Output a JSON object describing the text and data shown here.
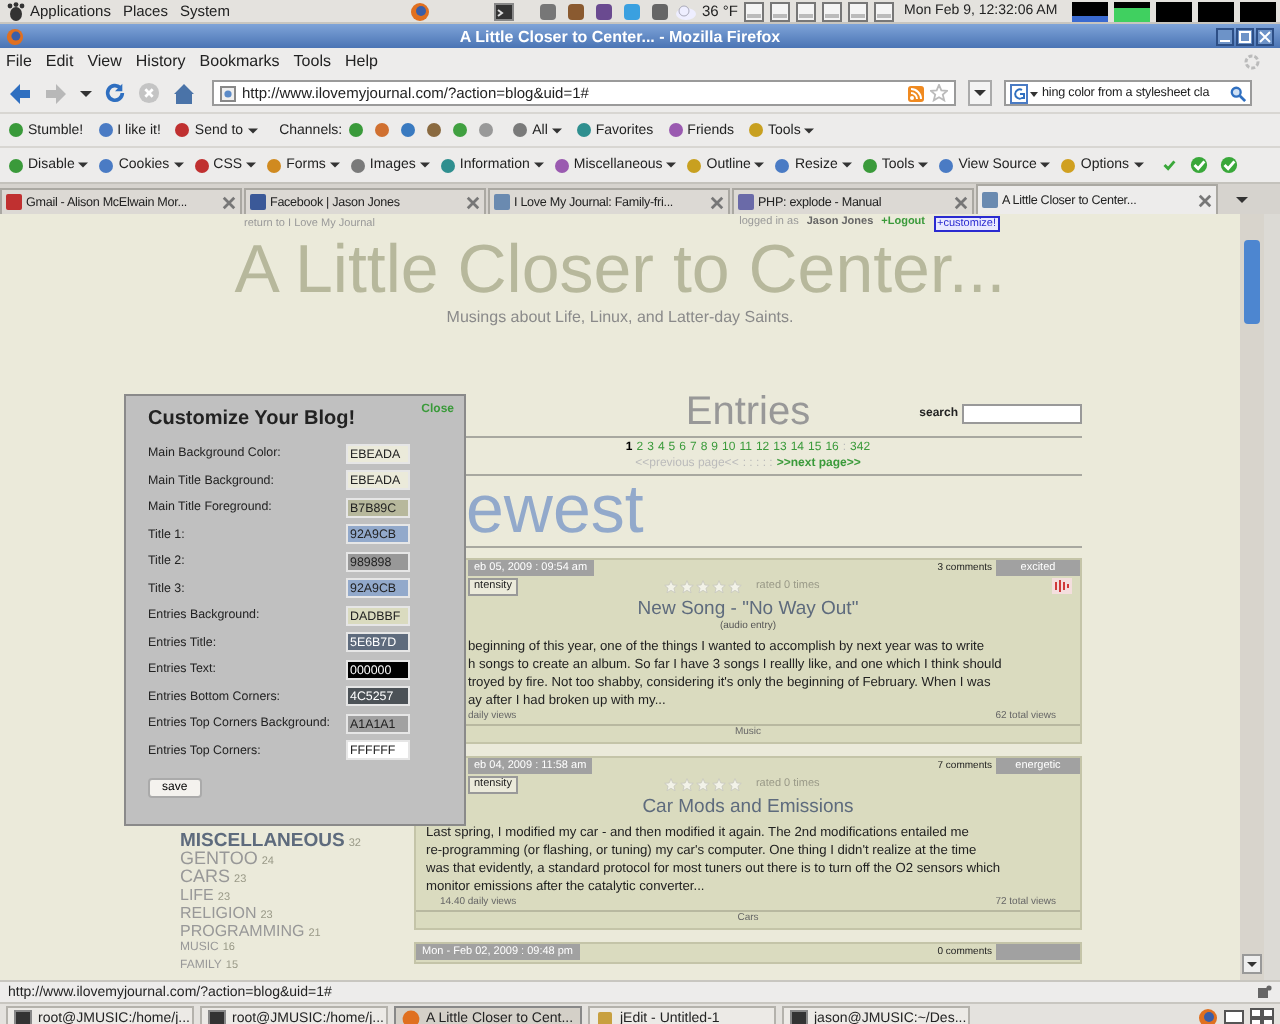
{
  "top_panel": {
    "menus": [
      "Applications",
      "Places",
      "System"
    ],
    "weather": "36 °F",
    "clock": "Mon Feb  9, 12:32:06 AM"
  },
  "window": {
    "title": "A Little Closer to Center... - Mozilla Firefox"
  },
  "menu_bar": [
    "File",
    "Edit",
    "View",
    "History",
    "Bookmarks",
    "Tools",
    "Help"
  ],
  "address_bar": {
    "value": "http://www.ilovemyjournal.com/?action=blog&uid=1#"
  },
  "search_bar": {
    "value": "hing color from a stylesheet cla"
  },
  "stumble_toolbar": [
    {
      "label": "Stumble!",
      "kind": "button"
    },
    {
      "label": "I like it!",
      "kind": "button"
    },
    {
      "label": "Send to",
      "kind": "menu"
    },
    {
      "label": "Channels:",
      "kind": "label"
    },
    {
      "label": "All",
      "kind": "menu"
    },
    {
      "label": "Favorites",
      "kind": "button"
    },
    {
      "label": "Friends",
      "kind": "button"
    },
    {
      "label": "Tools",
      "kind": "menu"
    }
  ],
  "developer_toolbar": [
    "Disable",
    "Cookies",
    "CSS",
    "Forms",
    "Images",
    "Information",
    "Miscellaneous",
    "Outline",
    "Resize",
    "Tools",
    "View Source",
    "Options"
  ],
  "tabs": [
    {
      "label": "Gmail - Alison McElwain Mor...",
      "selected": false
    },
    {
      "label": "Facebook | Jason Jones",
      "selected": false
    },
    {
      "label": "I Love My Journal: Family-fri...",
      "selected": false
    },
    {
      "label": "PHP: explode - Manual",
      "selected": false
    },
    {
      "label": "A Little Closer to Center...",
      "selected": true
    }
  ],
  "page": {
    "return_link": "return to I Love My Journal",
    "logged_in_label": "logged in as",
    "user": "Jason Jones",
    "logout_link": "+Logout",
    "customize_link": "+customize!",
    "title": "A Little Closer to Center...",
    "subtitle": "Musings about Life, Linux, and Latter-day Saints."
  },
  "customize_dialog": {
    "title": "Customize Your Blog!",
    "close": "Close",
    "save": "save",
    "fields": [
      {
        "label": "Main Background Color:",
        "value": "EBEADA",
        "color": "#ebeada"
      },
      {
        "label": "Main Title Background:",
        "value": "EBEADA",
        "color": "#ebeada"
      },
      {
        "label": "Main Title Foreground:",
        "value": "B7B89C",
        "color": "#b7b89c"
      },
      {
        "label": "Title 1:",
        "value": "92A9CB",
        "color": "#92a9cb"
      },
      {
        "label": "Title 2:",
        "value": "989898",
        "color": "#989898"
      },
      {
        "label": "Title 3:",
        "value": "92A9CB",
        "color": "#92a9cb"
      },
      {
        "label": "Entries Background:",
        "value": "DADBBF",
        "color": "#dadbbf"
      },
      {
        "label": "Entries Title:",
        "value": "5E6B7D",
        "color": "#5e6b7d"
      },
      {
        "label": "Entries Text:",
        "value": "000000",
        "color": "#000000"
      },
      {
        "label": "Entries Bottom Corners:",
        "value": "4C5257",
        "color": "#4c5257"
      },
      {
        "label": "Entries Top Corners Background:",
        "value": "A1A1A1",
        "color": "#a1a1a1"
      },
      {
        "label": "Entries Top Corners:",
        "value": "FFFFFF",
        "color": "#ffffff"
      }
    ]
  },
  "categories": [
    {
      "name": "MISCELLANEOUS",
      "count": "32"
    },
    {
      "name": "GENTOO",
      "count": "24"
    },
    {
      "name": "CARS",
      "count": "23"
    },
    {
      "name": "LIFE",
      "count": "23"
    },
    {
      "name": "RELIGION",
      "count": "23"
    },
    {
      "name": "PROGRAMMING",
      "count": "21"
    },
    {
      "name": "MUSIC",
      "count": "16"
    },
    {
      "name": "FAMILY",
      "count": "15"
    }
  ],
  "entries_header": {
    "title": "Entries",
    "search_label": "search",
    "pages": [
      {
        "label": "1",
        "selected": true
      },
      {
        "label": "2",
        "selected": false
      },
      {
        "label": "3",
        "selected": false
      },
      {
        "label": "4",
        "selected": false
      },
      {
        "label": "5",
        "selected": false
      },
      {
        "label": "6",
        "selected": false
      },
      {
        "label": "7",
        "selected": false
      },
      {
        "label": "8",
        "selected": false
      },
      {
        "label": "9",
        "selected": false
      },
      {
        "label": "10",
        "selected": false
      },
      {
        "label": "11",
        "selected": false
      },
      {
        "label": "12",
        "selected": false
      },
      {
        "label": "13",
        "selected": false
      },
      {
        "label": "14",
        "selected": false
      },
      {
        "label": "15",
        "selected": false
      },
      {
        "label": "16",
        "selected": false
      }
    ],
    "ellipsis": ":",
    "last_page": "342",
    "previous": "<<previous page<<",
    "separators": ": : : : :",
    "next": ">>next page>>"
  },
  "section_heading": "ewest",
  "entries": [
    {
      "date": "eb 05, 2009 : 09:54 am",
      "intensity": "ntensity",
      "stars": 0,
      "rating": "rated 0 times",
      "comments": "3 comments",
      "mood": "excited",
      "has_audio": true,
      "title": "New Song - \"No Way Out\"",
      "subtitle": "(audio entry)",
      "body": [
        "beginning of this year, one of the things I wanted to accomplish by next year was to write",
        "h songs to create an album.  So far I have 3 songs I reallly like, and one which I think should",
        "troyed by fire.  Not too shabby, considering it's only the beginning of February. When I was",
        "ay after I had broken up with my..."
      ],
      "daily_views": "daily views",
      "total_views": "62 total views",
      "category": "Music"
    },
    {
      "date": "eb 04, 2009 : 11:58 am",
      "intensity": "ntensity",
      "stars": 0,
      "rating": "rated 0 times",
      "comments": "7 comments",
      "mood": "energetic",
      "has_audio": false,
      "title": "Car Mods and Emissions",
      "body": [
        "Last spring, I modified my car - and then modified it again. The 2nd modifications entailed me",
        "re-programming (or flashing, or tuning) my car's computer.  One thing I didn't realize at the time",
        "was that evidently, a standard protocol for most tuners out there is to turn off the O2 sensors which",
        "monitor emissions after the catalytic converter..."
      ],
      "daily_views": "14.40 daily views",
      "total_views": "72 total views",
      "category": "Cars"
    },
    {
      "date": "Mon - Feb 02, 2009 : 09:48 pm",
      "comments": "0 comments",
      "has_audio": false
    }
  ],
  "status_bar": "http://www.ilovemyjournal.com/?action=blog&uid=1#",
  "taskbar": [
    {
      "label": "root@JMUSIC:/home/j...",
      "kind": "terminal",
      "selected": false
    },
    {
      "label": "root@JMUSIC:/home/j...",
      "kind": "terminal",
      "selected": false
    },
    {
      "label": "A Little Closer to Cent...",
      "kind": "browser",
      "selected": true
    },
    {
      "label": "jEdit - Untitled-1",
      "kind": "editor",
      "selected": false
    },
    {
      "label": "jason@JMUSIC:~/Des...",
      "kind": "terminal",
      "selected": false
    }
  ]
}
